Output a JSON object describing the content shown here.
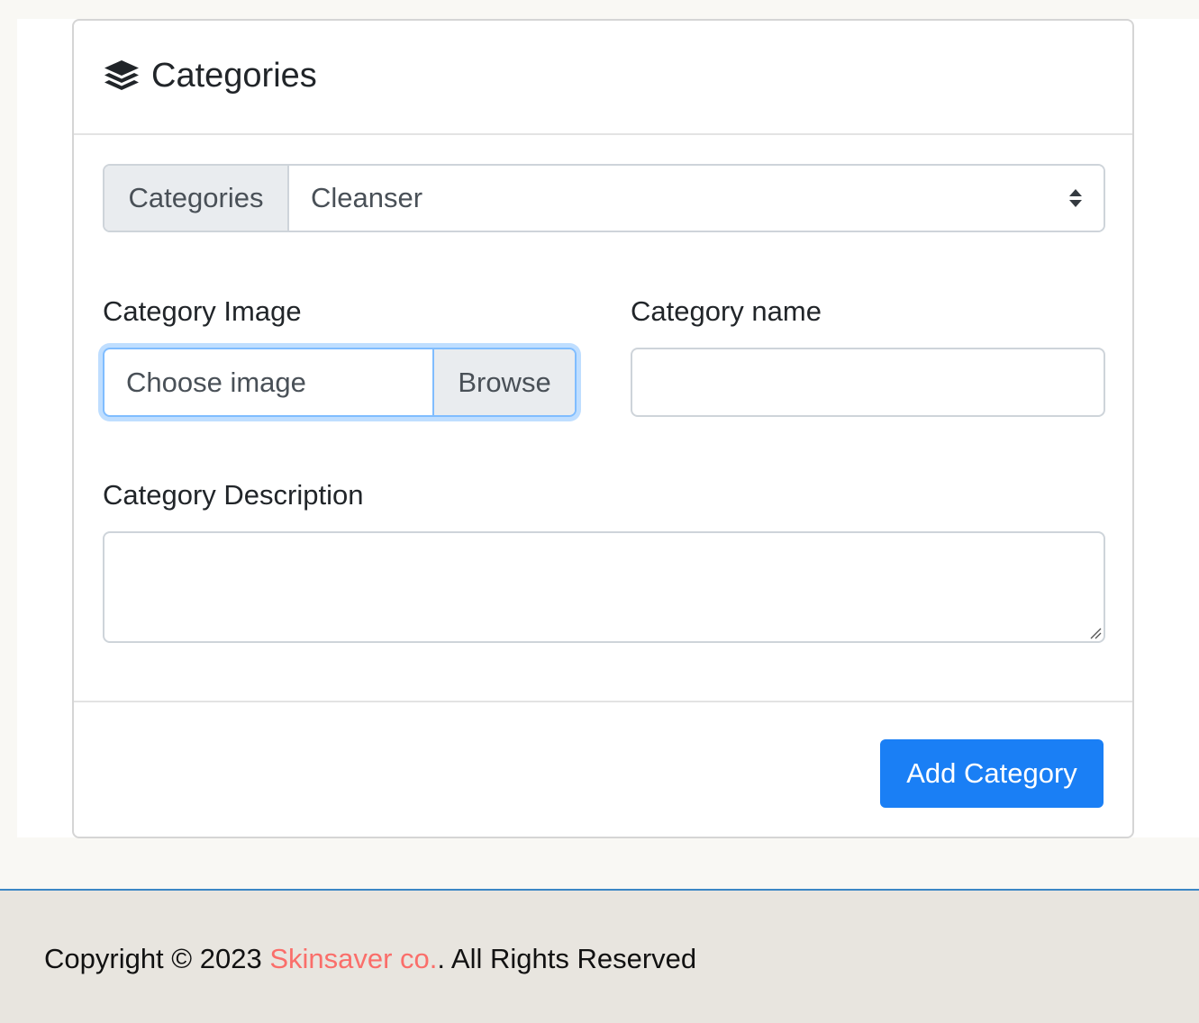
{
  "card": {
    "title": "Categories",
    "title_icon": "layers-icon"
  },
  "category_select": {
    "prepend_label": "Categories",
    "selected_value": "Cleanser"
  },
  "form": {
    "image_label": "Category Image",
    "image_placeholder": "Choose image",
    "browse_label": "Browse",
    "name_label": "Category name",
    "name_value": "",
    "description_label": "Category Description",
    "description_value": ""
  },
  "footer_actions": {
    "add_button_label": "Add Category"
  },
  "page_footer": {
    "copyright_prefix": "Copyright © 2023 ",
    "brand": "Skinsaver co.",
    "copyright_suffix": ". All Rights Reserved"
  },
  "colors": {
    "primary": "#1a7ff5",
    "brand": "#fa6e6a",
    "footer_bg": "#e8e5df",
    "footer_border": "#3b86c4",
    "focus_ring": "#80bdff"
  }
}
